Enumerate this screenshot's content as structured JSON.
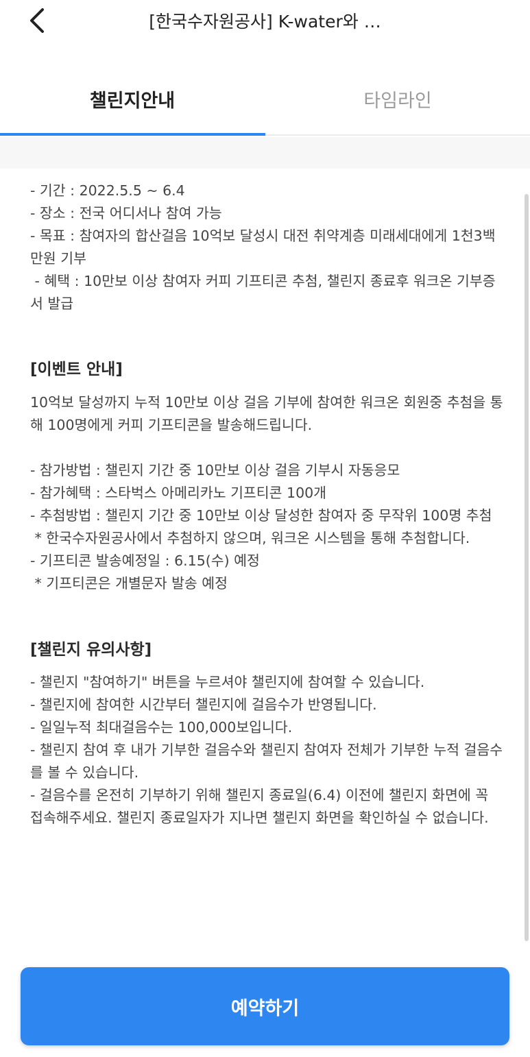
{
  "header": {
    "title": "[한국수자원공사] K-water와 …",
    "back_icon": "chevron-left-icon"
  },
  "tabs": [
    {
      "label": "챌린지안내",
      "active": true
    },
    {
      "label": "타임라인",
      "active": false
    }
  ],
  "colors": {
    "accent": "#2e86f0",
    "inactive_tab": "#9b9b9b"
  },
  "content": {
    "intro": "- 기간 : 2022.5.5 ~ 6.4\n- 장소 : 전국 어디서나 참여 가능\n- 목표 : 참여자의 합산걸음 10억보 달성시 대전 취약계층 미래세대에게 1천3백만원 기부\n - 혜택 : 10만보 이상 참여자 커피 기프티콘 추첨, 챌린지 종료후 워크온 기부증서 발급",
    "event_title": "[이벤트 안내]",
    "event_text_1": "10억보 달성까지 누적 10만보 이상 걸음 기부에 참여한 워크온 회원중 추첨을 통해 100명에게 커피 기프티콘을 발송해드립니다.",
    "event_text_2": "- 참가방법 : 챌린지 기간 중 10만보 이상 걸음 기부시 자동응모\n- 참가혜택 : 스타벅스 아메리카노 기프티콘 100개\n- 추첨방법 : 챌린지 기간 중 10만보 이상 달성한 참여자 중 무작위 100명 추첨\n * 한국수자원공사에서 추첨하지 않으며, 워크온 시스템을 통해 추첨합니다.\n- 기프티콘 발송예정일 : 6.15(수) 예정\n * 기프티콘은 개별문자 발송 예정",
    "notice_title": "[챌린지 유의사항]",
    "notice_text": "- 챌린지 \"참여하기\" 버튼을 누르셔야 챌린지에 참여할 수 있습니다.\n- 챌린지에 참여한 시간부터 챌린지에 걸음수가 반영됩니다.\n- 일일누적 최대걸음수는 100,000보입니다.\n- 챌린지 참여 후 내가 기부한 걸음수와 챌린지 참여자 전체가 기부한 누적 걸음수를 볼 수 있습니다.\n- 걸음수를 온전히 기부하기 위해 챌린지 종료일(6.4) 이전에 챌린지 화면에 꼭 접속해주세요. 챌린지 종료일자가 지나면 챌린지 화면을 확인하실 수 없습니다."
  },
  "footer": {
    "reserve_label": "예약하기"
  }
}
